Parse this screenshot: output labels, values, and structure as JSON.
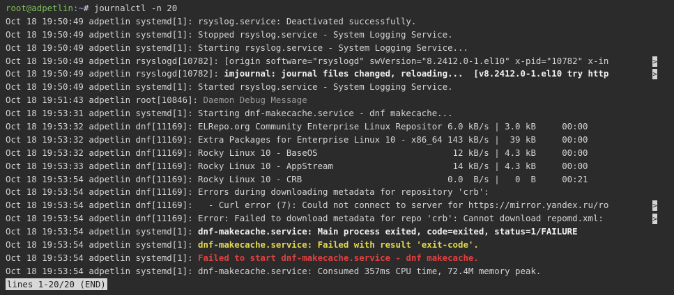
{
  "prompt": {
    "user": "root@adpetlin",
    "path": ":~",
    "rest": "# journalctl -n 20"
  },
  "lines": [
    {
      "text": "Oct 18 19:50:49 adpetlin systemd[1]: rsyslog.service: Deactivated successfully."
    },
    {
      "text": "Oct 18 19:50:49 adpetlin systemd[1]: Stopped rsyslog.service - System Logging Service."
    },
    {
      "text": "Oct 18 19:50:49 adpetlin systemd[1]: Starting rsyslog.service - System Logging Service..."
    },
    {
      "text": "Oct 18 19:50:49 adpetlin rsyslogd[10782]: [origin software=\"rsyslogd\" swVersion=\"8.2412.0-1.el10\" x-pid=\"10782\" x-in"
    },
    {
      "prefix": "Oct 18 19:50:49 adpetlin rsyslogd[10782]: ",
      "highlight": "imjournal: journal files changed, reloading...  [v8.2412.0-1.el10 try http",
      "style": "bold"
    },
    {
      "text": "Oct 18 19:50:49 adpetlin systemd[1]: Started rsyslog.service - System Logging Service."
    },
    {
      "prefix": "Oct 18 19:51:43 adpetlin root[10846]: ",
      "highlight": "Daemon Debug Message",
      "style": "dim"
    },
    {
      "text": "Oct 18 19:53:31 adpetlin systemd[1]: Starting dnf-makecache.service - dnf makecache..."
    },
    {
      "text": "Oct 18 19:53:32 adpetlin dnf[11169]: ELRepo.org Community Enterprise Linux Repositor 6.0 kB/s | 3.0 kB     00:00"
    },
    {
      "text": "Oct 18 19:53:32 adpetlin dnf[11169]: Extra Packages for Enterprise Linux 10 - x86_64 143 kB/s |  39 kB     00:00"
    },
    {
      "text": "Oct 18 19:53:32 adpetlin dnf[11169]: Rocky Linux 10 - BaseOS                          12 kB/s | 4.3 kB     00:00"
    },
    {
      "text": "Oct 18 19:53:33 adpetlin dnf[11169]: Rocky Linux 10 - AppStream                       14 kB/s | 4.3 kB     00:00"
    },
    {
      "text": "Oct 18 19:53:54 adpetlin dnf[11169]: Rocky Linux 10 - CRB                            0.0  B/s |   0  B     00:21"
    },
    {
      "text": "Oct 18 19:53:54 adpetlin dnf[11169]: Errors during downloading metadata for repository 'crb':"
    },
    {
      "text": "Oct 18 19:53:54 adpetlin dnf[11169]:   - Curl error (7): Could not connect to server for https://mirror.yandex.ru/ro"
    },
    {
      "text": "Oct 18 19:53:54 adpetlin dnf[11169]: Error: Failed to download metadata for repo 'crb': Cannot download repomd.xml: "
    },
    {
      "prefix": "Oct 18 19:53:54 adpetlin systemd[1]: ",
      "highlight": "dnf-makecache.service: Main process exited, code=exited, status=1/FAILURE",
      "style": "bold"
    },
    {
      "prefix": "Oct 18 19:53:54 adpetlin systemd[1]: ",
      "highlight": "dnf-makecache.service: Failed with result 'exit-code'.",
      "style": "warn"
    },
    {
      "prefix": "Oct 18 19:53:54 adpetlin systemd[1]: ",
      "highlight": "Failed to start dnf-makecache.service - dnf makecache.",
      "style": "err"
    },
    {
      "text": "Oct 18 19:53:54 adpetlin systemd[1]: dnf-makecache.service: Consumed 357ms CPU time, 72.4M memory peak."
    }
  ],
  "truncated_lines": [
    3,
    4,
    14,
    15
  ],
  "truncation_glyph": ">",
  "status": "lines 1-20/20 (END)"
}
